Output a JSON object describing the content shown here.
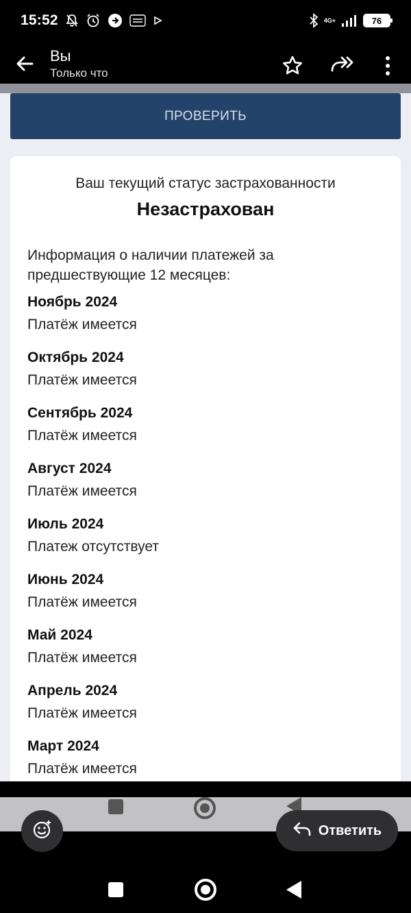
{
  "status_bar": {
    "time": "15:52",
    "network": "4G+",
    "battery": "76",
    "notification_icons": [
      "muted-bell-icon",
      "alarm-icon",
      "navigation-icon",
      "temu-icon",
      "play-icon"
    ],
    "right_icons": [
      "bluetooth-icon",
      "signal-icon",
      "battery-icon"
    ]
  },
  "app_bar": {
    "title": "Вы",
    "subtitle": "Только что",
    "icons": [
      "back-arrow-icon",
      "star-icon",
      "forward-icon",
      "more-vert-icon"
    ]
  },
  "check_button": {
    "label": "ПРОВЕРИТЬ"
  },
  "card": {
    "status_caption": "Ваш текущий статус застрахованности",
    "status_value": "Незастрахован",
    "info_text": "Информация о наличии платежей за предшествующие 12 месяцев:",
    "months": [
      {
        "name": "Ноябрь 2024",
        "status": "Платёж имеется"
      },
      {
        "name": "Октябрь 2024",
        "status": "Платёж имеется"
      },
      {
        "name": "Сентябрь 2024",
        "status": "Платёж имеется"
      },
      {
        "name": "Август 2024",
        "status": "Платёж имеется"
      },
      {
        "name": "Июль 2024",
        "status": "Платеж отсутствует"
      },
      {
        "name": "Июнь 2024",
        "status": "Платёж имеется"
      },
      {
        "name": "Май 2024",
        "status": "Платёж имеется"
      },
      {
        "name": "Апрель 2024",
        "status": "Платёж имеется"
      },
      {
        "name": "Март 2024",
        "status": "Платёж имеется"
      }
    ]
  },
  "bottom": {
    "reply_label": "Ответить",
    "icons": [
      "emoji-icon",
      "reply-arrow-icon"
    ]
  },
  "nav": {
    "icons": [
      "recents-icon",
      "home-icon",
      "back-icon"
    ]
  },
  "colors": {
    "button_bg": "#24436b",
    "page_bg": "#eceef3",
    "card_bg": "#ffffff",
    "chip_bg": "#2f2f31"
  }
}
